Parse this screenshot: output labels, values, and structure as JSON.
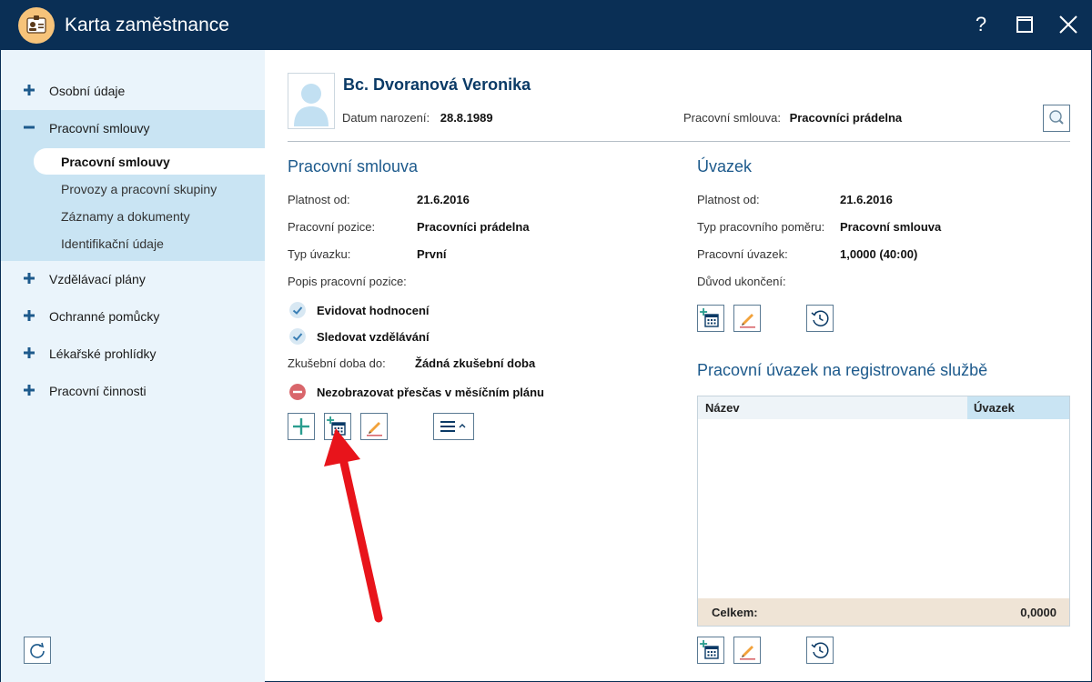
{
  "window": {
    "title": "Karta zaměstnance",
    "help_label": "?"
  },
  "sidebar": {
    "items": [
      {
        "label": "Osobní údaje",
        "expander": "plus"
      },
      {
        "label": "Pracovní smlouvy",
        "expander": "minus"
      },
      {
        "label": "Vzdělávací plány",
        "expander": "plus"
      },
      {
        "label": "Ochranné pomůcky",
        "expander": "plus"
      },
      {
        "label": "Lékařské prohlídky",
        "expander": "plus"
      },
      {
        "label": "Pracovní činnosti",
        "expander": "plus"
      }
    ],
    "subitems": [
      {
        "label": "Pracovní smlouvy",
        "active": true
      },
      {
        "label": "Provozy a pracovní skupiny",
        "active": false
      },
      {
        "label": "Záznamy a dokumenty",
        "active": false
      },
      {
        "label": "Identifikační údaje",
        "active": false
      }
    ]
  },
  "header": {
    "name": "Bc. Dvoranová Veronika",
    "birth_label": "Datum narození:",
    "birth_value": "28.8.1989",
    "contract_label": "Pracovní smlouva:",
    "contract_value": "Pracovníci prádelna"
  },
  "contract": {
    "title": "Pracovní smlouva",
    "rows": [
      {
        "label": "Platnost od:",
        "value": "21.6.2016"
      },
      {
        "label": "Pracovní pozice:",
        "value": "Pracovníci prádelna"
      },
      {
        "label": "Typ úvazku:",
        "value": "První"
      },
      {
        "label": "Popis pracovní pozice:",
        "value": ""
      }
    ],
    "checks": [
      {
        "label": "Evidovat hodnocení",
        "state": "checked"
      },
      {
        "label": "Sledovat vzdělávání",
        "state": "checked"
      }
    ],
    "trial_label": "Zkušební doba do:",
    "trial_value": "Žádná zkušební doba",
    "overtime_label": "Nezobrazovat přesčas v měsíčním plánu"
  },
  "workload": {
    "title": "Úvazek",
    "rows": [
      {
        "label": "Platnost od:",
        "value": "21.6.2016"
      },
      {
        "label": "Typ pracovního poměru:",
        "value": "Pracovní smlouva"
      },
      {
        "label": "Pracovní úvazek:",
        "value": "1,0000 (40:00)"
      },
      {
        "label": "Důvod ukončení:",
        "value": ""
      }
    ]
  },
  "service": {
    "title": "Pracovní úvazek na registrované službě",
    "columns": [
      "Název",
      "Úvazek"
    ],
    "rows": [],
    "total_label": "Celkem:",
    "total_value": "0,0000"
  },
  "colors": {
    "titlebar": "#0a2f55",
    "accent": "#1d5a8c",
    "check": "#3a7fb5",
    "remove": "#d9666b",
    "add": "#2a9d8f",
    "arrow": "#e8141b"
  }
}
